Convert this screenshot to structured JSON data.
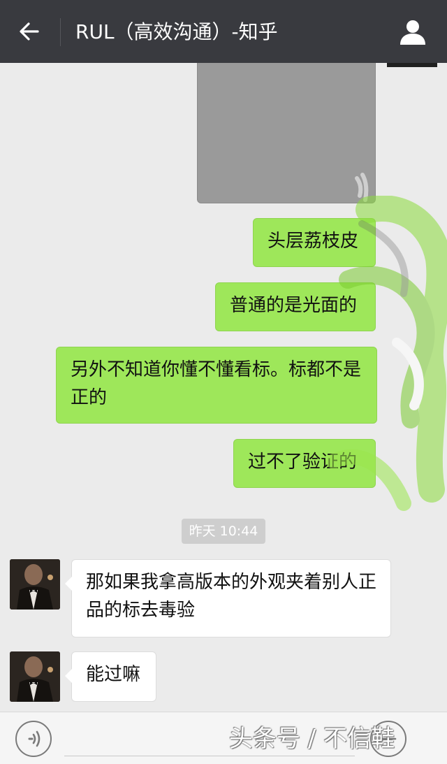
{
  "header": {
    "title": "RUL（高效沟通）-知乎",
    "back_icon": "arrow-left-icon",
    "profile_icon": "person-icon"
  },
  "messages": [
    {
      "type": "image",
      "direction": "out"
    },
    {
      "type": "text",
      "direction": "out",
      "text": "头层荔枝皮"
    },
    {
      "type": "text",
      "direction": "out",
      "text": "普通的是光面的"
    },
    {
      "type": "text",
      "direction": "out",
      "text": "另外不知道你懂不懂看标。标都不是正的"
    },
    {
      "type": "text",
      "direction": "out",
      "text": "过不了验证的"
    },
    {
      "type": "timestamp",
      "text": "昨天 10:44"
    },
    {
      "type": "text",
      "direction": "in",
      "text": "那如果我拿高版本的外观夹着别人正品的标去毒验"
    },
    {
      "type": "text",
      "direction": "in",
      "text": "能过嘛"
    }
  ],
  "input_bar": {
    "voice_icon": "voice-icon",
    "plus_icon": "plus-icon",
    "watermark": "头条号 / 不信鞋"
  },
  "colors": {
    "header_bg": "#393a3f",
    "chat_bg": "#ebebeb",
    "outgoing_bubble": "#9ee75a",
    "incoming_bubble": "#ffffff"
  }
}
